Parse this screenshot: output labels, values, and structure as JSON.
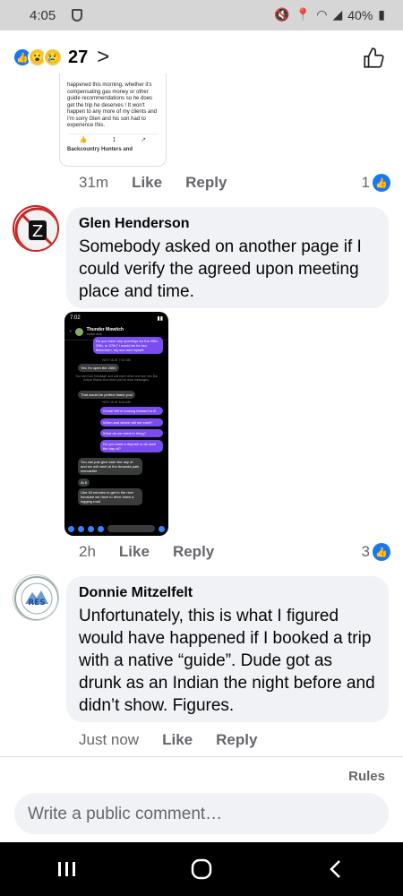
{
  "status_bar": {
    "time": "4:05",
    "battery": "40%"
  },
  "reactions": {
    "count": "27",
    "icons": [
      "like-icon",
      "wow-icon",
      "sad-icon"
    ]
  },
  "comments": [
    {
      "author": "",
      "time": "31m",
      "like_label": "Like",
      "reply_label": "Reply",
      "like_count": "1",
      "embedded_text": "happened this morning, whether it's compensating gas money or other guide recommendations so he does get the trip he deserves ! It won't happen to any more of my clients and I'm sorry Glen and his son had to experience this.",
      "embedded_reply_count": "1",
      "embedded_footer": "Backcountry Hunters and"
    },
    {
      "author": "Glen Henderson",
      "text": "Somebody asked on another page if I could verify the agreed upon meeting place and time.",
      "time": "2h",
      "like_label": "Like",
      "reply_label": "Reply",
      "like_count": "3",
      "screenshot": {
        "time": "7:02",
        "contact": "Thunder Mowitch",
        "contact_sub": "Active now",
        "messages": [
          "Do you have any openings for the 25th, 26th, or 27th? I would be for two fishermen, my son and myself.",
          "Yes I'm open the 26th!",
          "That would be perfect thank you!",
          "Great! We're looking forward to it!",
          "When and where will we meet?",
          "What do we need to bring?",
          "Do you want a deposit or all cash the day of?",
          "You can just give cash the day of and we will meet at the Amanda park mercantile",
          "At 6",
          "Like 40 minutes to get to the river because we have to drive down a logging road"
        ],
        "sys_1": "NOV 16 AT 7:42 AM",
        "sys_2": "You can now message and call each other and see info like Active Status and when you've read messages.",
        "sys_3": "NOV 16 AT 8:54 AM"
      }
    },
    {
      "author": "Donnie Mitzelfelt",
      "text": "Unfortunately, this is what I figured would have happened if I booked a trip with a native “guide”. Dude got as drunk as an Indian the night before and didn’t show. Figures.",
      "time": "Just now",
      "like_label": "Like",
      "reply_label": "Reply",
      "avatar_badge": "RES"
    }
  ],
  "footer": {
    "rules_label": "Rules",
    "composer_placeholder": "Write a public comment…"
  },
  "colors": {
    "accent": "#1877f2",
    "bubble": "#f0f2f5",
    "meta": "#65676b"
  }
}
